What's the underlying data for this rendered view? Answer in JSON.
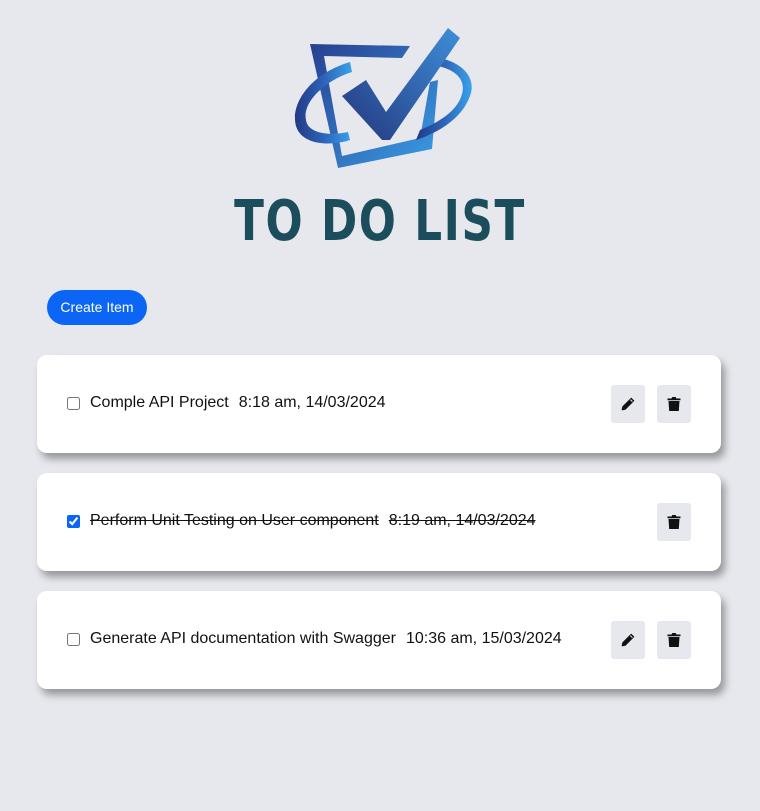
{
  "app": {
    "title": "TO DO LIST",
    "logo_icon": "checkbox-check-logo-icon"
  },
  "toolbar": {
    "create_label": "Create Item"
  },
  "items": [
    {
      "text": "Comple API Project",
      "time": "8:18 am, 14/03/2024",
      "completed": false,
      "actions": [
        "edit-icon",
        "trash-icon"
      ]
    },
    {
      "text": "Perform Unit Testing on User component",
      "time": "8:19 am, 14/03/2024",
      "completed": true,
      "actions": [
        "trash-icon"
      ]
    },
    {
      "text": "Generate API documentation with Swagger",
      "time": "10:36 am, 15/03/2024",
      "completed": false,
      "actions": [
        "edit-icon",
        "trash-icon"
      ]
    }
  ],
  "colors": {
    "background": "#e7e8ed",
    "accent": "#0c66f5",
    "title": "#1c4d5c",
    "logo_dark": "#283f8f",
    "logo_light": "#3a9ee6"
  }
}
